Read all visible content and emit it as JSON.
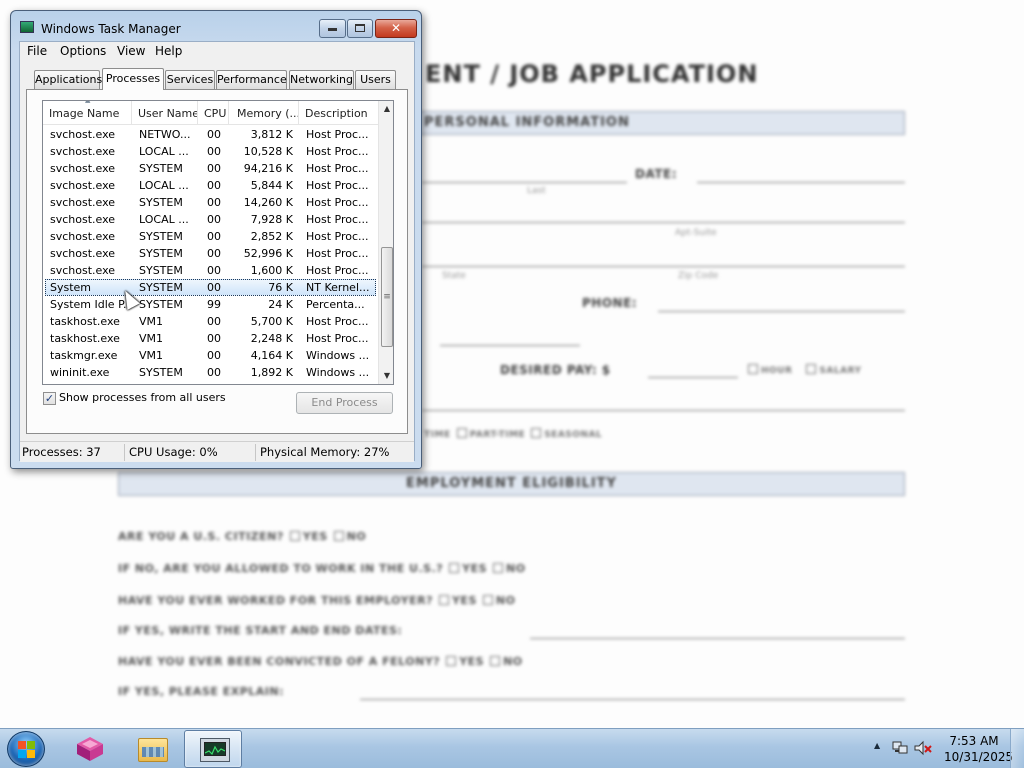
{
  "document": {
    "title": "ENT / JOB APPLICATION",
    "section1": "PERSONAL INFORMATION",
    "section2": "EMPLOYMENT ELIGIBILITY",
    "date_label": "DATE:",
    "last_label": "Last",
    "apt_label": "Apt-Suite",
    "state_label": "State",
    "zip_label": "Zip Code",
    "phone_label": "PHONE:",
    "pay_label": "DESIRED PAY: $",
    "hour_label": "HOUR",
    "salary_label": "SALARY",
    "time_label": "TIME",
    "parttime_label": "PART-TIME",
    "seasonal_label": "SEASONAL",
    "q1": "ARE YOU A U.S. CITIZEN?",
    "q2": "IF NO, ARE YOU ALLOWED TO WORK IN THE U.S.?",
    "q3": "HAVE YOU EVER WORKED FOR THIS EMPLOYER?",
    "q4": "IF YES, WRITE THE START AND END DATES:",
    "q5": "HAVE YOU EVER BEEN CONVICTED OF A FELONY?",
    "q6": "IF YES, PLEASE EXPLAIN:",
    "yes": "YES",
    "no": "NO"
  },
  "window": {
    "title": "Windows Task Manager",
    "menu": [
      "File",
      "Options",
      "View",
      "Help"
    ],
    "tabs": [
      "Applications",
      "Processes",
      "Services",
      "Performance",
      "Networking",
      "Users"
    ],
    "active_tab": "Processes",
    "columns": [
      "Image Name",
      "User Name",
      "CPU",
      "Memory (...",
      "Description"
    ],
    "rows": [
      {
        "image": "svchost.exe",
        "user": "NETWO...",
        "cpu": "00",
        "mem": "3,812 K",
        "desc": "Host Proc..."
      },
      {
        "image": "svchost.exe",
        "user": "LOCAL ...",
        "cpu": "00",
        "mem": "10,528 K",
        "desc": "Host Proc..."
      },
      {
        "image": "svchost.exe",
        "user": "SYSTEM",
        "cpu": "00",
        "mem": "94,216 K",
        "desc": "Host Proc..."
      },
      {
        "image": "svchost.exe",
        "user": "LOCAL ...",
        "cpu": "00",
        "mem": "5,844 K",
        "desc": "Host Proc..."
      },
      {
        "image": "svchost.exe",
        "user": "SYSTEM",
        "cpu": "00",
        "mem": "14,260 K",
        "desc": "Host Proc..."
      },
      {
        "image": "svchost.exe",
        "user": "LOCAL ...",
        "cpu": "00",
        "mem": "7,928 K",
        "desc": "Host Proc..."
      },
      {
        "image": "svchost.exe",
        "user": "SYSTEM",
        "cpu": "00",
        "mem": "2,852 K",
        "desc": "Host Proc..."
      },
      {
        "image": "svchost.exe",
        "user": "SYSTEM",
        "cpu": "00",
        "mem": "52,996 K",
        "desc": "Host Proc..."
      },
      {
        "image": "svchost.exe",
        "user": "SYSTEM",
        "cpu": "00",
        "mem": "1,600 K",
        "desc": "Host Proc..."
      },
      {
        "image": "System",
        "user": "SYSTEM",
        "cpu": "00",
        "mem": "76 K",
        "desc": "NT Kernel...",
        "selected": true
      },
      {
        "image": "System Idle P...",
        "user": "SYSTEM",
        "cpu": "99",
        "mem": "24 K",
        "desc": "Percenta..."
      },
      {
        "image": "taskhost.exe",
        "user": "VM1",
        "cpu": "00",
        "mem": "5,700 K",
        "desc": "Host Proc..."
      },
      {
        "image": "taskhost.exe",
        "user": "VM1",
        "cpu": "00",
        "mem": "2,248 K",
        "desc": "Host Proc..."
      },
      {
        "image": "taskmgr.exe",
        "user": "VM1",
        "cpu": "00",
        "mem": "4,164 K",
        "desc": "Windows ..."
      },
      {
        "image": "wininit.exe",
        "user": "SYSTEM",
        "cpu": "00",
        "mem": "1,892 K",
        "desc": "Windows ..."
      }
    ],
    "show_all_label": "Show processes from all users",
    "show_all_checked": true,
    "end_process_label": "End Process",
    "status": {
      "processes": "Processes: 37",
      "cpu": "CPU Usage: 0%",
      "memory": "Physical Memory: 27%"
    }
  },
  "taskbar": {
    "clock_time": "7:53 AM",
    "clock_date": "10/31/2025",
    "pinned": [
      "start-orb",
      "cube-app-icon",
      "file-explorer-icon",
      "task-manager-icon"
    ]
  },
  "colors": {
    "selection": "#cfe4fa",
    "taskbar": "#a9c6e3",
    "close_button": "#c2391f"
  }
}
